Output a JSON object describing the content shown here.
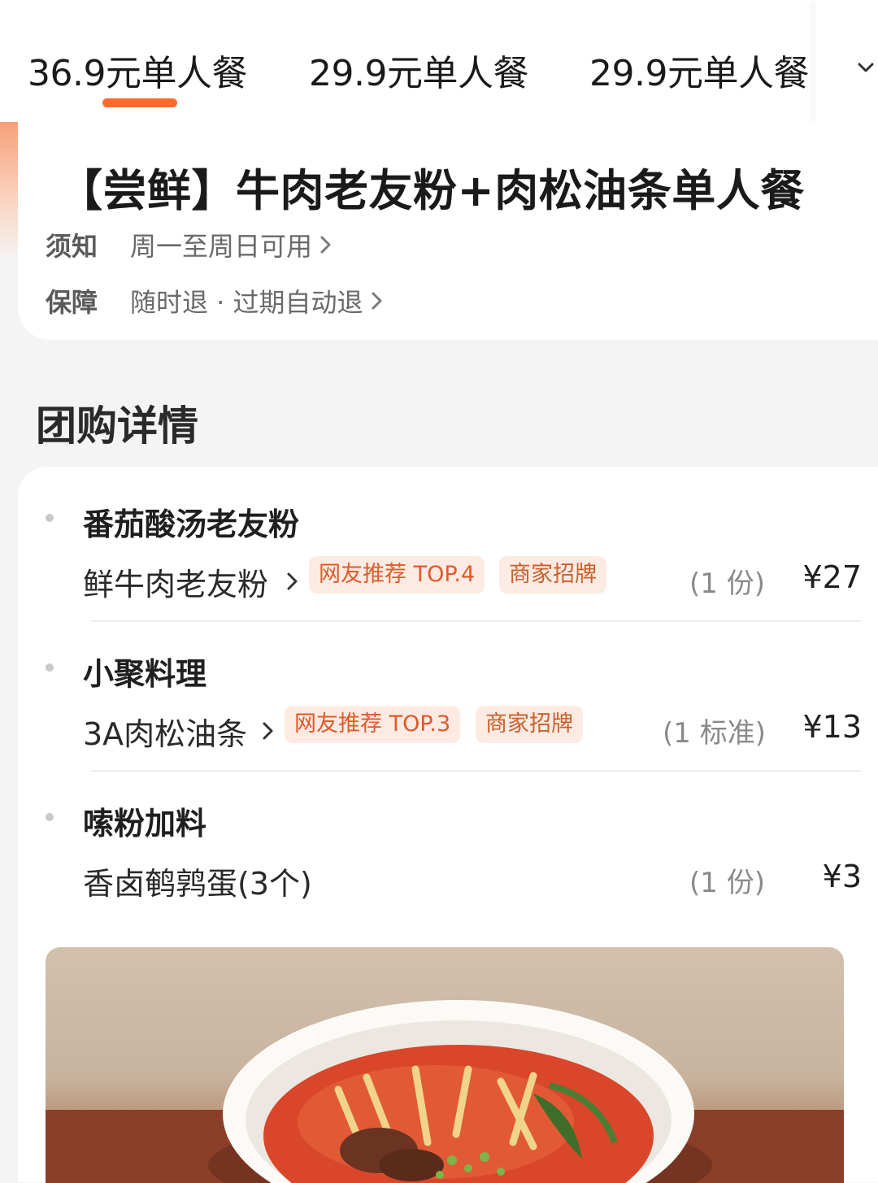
{
  "tabs": [
    {
      "label": "36.9元单人餐",
      "active": true
    },
    {
      "label": "29.9元单人餐",
      "active": false
    },
    {
      "label": "29.9元单人餐",
      "active": false
    }
  ],
  "tab_more_icon": "chevron-down-icon",
  "accent_color": "#ff6a2b",
  "deal": {
    "title": "【尝鲜】牛肉老友粉+肉松油条单人餐",
    "notice_key": "须知",
    "notice_value": "周一至周日可用",
    "guarantee_key": "保障",
    "guarantee_value": "随时退 · 过期自动退"
  },
  "section_title": "团购详情",
  "groups": [
    {
      "name": "番茄酸汤老友粉",
      "item": "鲜牛肉老友粉",
      "tags": [
        "网友推荐 TOP.4",
        "商家招牌"
      ],
      "qty": "(1 份)",
      "price": "¥27"
    },
    {
      "name": "小聚料理",
      "item": "3A肉松油条",
      "tags": [
        "网友推荐 TOP.3",
        "商家招牌"
      ],
      "qty": "(1 标准)",
      "price": "¥13"
    },
    {
      "name": "嗦粉加料",
      "item": "香卤鹌鹑蛋(3个)",
      "tags": [],
      "qty": "(1 份)",
      "price": "¥3"
    }
  ]
}
